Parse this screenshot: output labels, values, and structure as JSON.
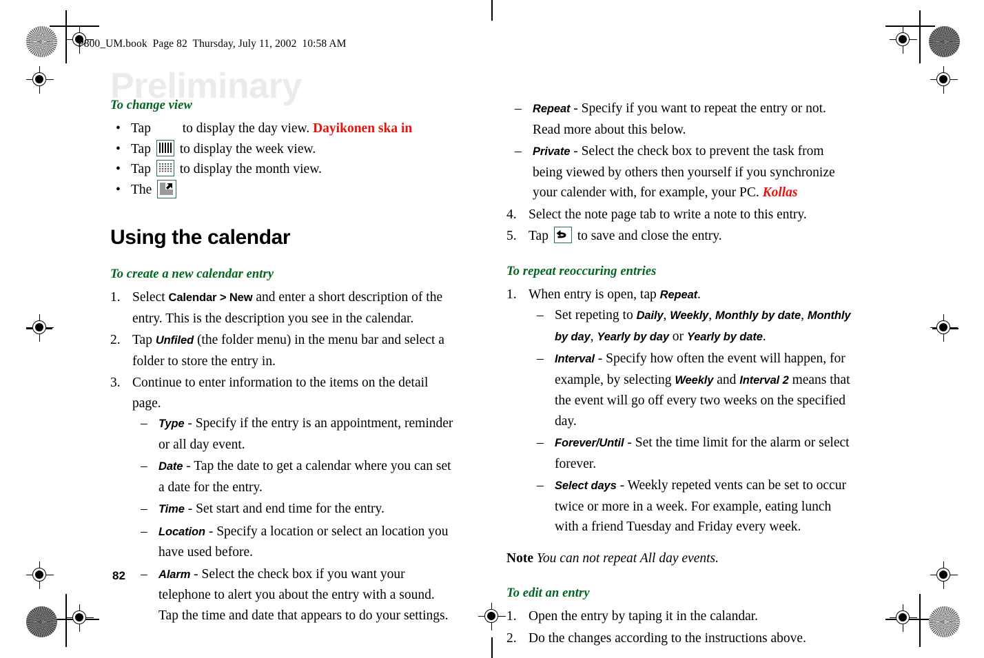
{
  "document": {
    "running_header": "P800_UM.book  Page 82  Thursday, July 11, 2002  10:58 AM",
    "watermark": "Preliminary",
    "page_number": "82"
  },
  "colors": {
    "heading_green": "#00661f",
    "alert_red": "#e8140c",
    "icon_border_green": "#2a6b55",
    "watermark_gray": "#ebebeb"
  },
  "left_column": {
    "section_to_change_view": {
      "heading": "To change view",
      "bullets": [
        {
          "lead": "Tap",
          "icon": "day-view-icon",
          "text": "to display the day view.",
          "alert": "Dayikonen ska in"
        },
        {
          "lead": "Tap",
          "icon": "week-view-icon",
          "text": "to display the week view.",
          "alert": ""
        },
        {
          "lead": "Tap",
          "icon": "month-view-icon",
          "text": "to display the month view.",
          "alert": ""
        },
        {
          "lead": "The",
          "icon": "minimize-corner-icon",
          "text": "",
          "alert": ""
        }
      ]
    },
    "main_heading": "Using the calendar",
    "section_create_entry": {
      "heading": "To create a new calendar entry",
      "steps": [
        {
          "num": "1.",
          "pre": "Select ",
          "ui": "Calendar > New",
          "post": " and enter a short description of the entry. This is the description you see in the calendar."
        },
        {
          "num": "2.",
          "pre": "Tap ",
          "ui": "Unfiled",
          "post": " (the folder menu) in the menu bar and select a folder to store the entry in."
        },
        {
          "num": "3.",
          "pre": "Continue to enter information to the items on the detail page.",
          "ui": "",
          "post": ""
        }
      ],
      "sub_items": [
        {
          "term": "Type",
          "text": " - Specify if the entry is an appointment, reminder or all day event."
        },
        {
          "term": "Date",
          "text": " - Tap the date to get a calendar where you can set a date for the entry."
        },
        {
          "term": "Time",
          "text": " - Set start and end time for the entry."
        },
        {
          "term": "Location",
          "text": " - Specify a location or select an location you have used before."
        },
        {
          "term": "Alarm",
          "text": " - Select the check box if you want your telephone to alert you about the entry with a sound. Tap the time and date that appears to do your settings."
        }
      ]
    }
  },
  "right_column": {
    "continued_sub_items": [
      {
        "term": "Repeat",
        "text": " - Specify if you want to repeat the entry or not. Read more about this below.",
        "alert": ""
      },
      {
        "term": "Private",
        "text": " - Select the check box to prevent the task from being viewed by others then yourself if you synchronize your calender with, for example, your PC. ",
        "alert": "Kollas"
      }
    ],
    "steps_continued": [
      {
        "num": "4.",
        "pre": "Select the note page tab to write a note to this entry.",
        "icon": "",
        "post": ""
      },
      {
        "num": "5.",
        "pre": "Tap ",
        "icon": "back-arrow-icon",
        "post": " to save and close the entry."
      }
    ],
    "section_repeat": {
      "heading": "To repeat reoccuring entries",
      "step": {
        "num": "1.",
        "pre": "When entry is open, tap ",
        "ui": "Repeat",
        "post": "."
      },
      "sub_items": [
        {
          "term": "",
          "text_parts": [
            "Set repeting to ",
            "Daily",
            ", ",
            "Weekly",
            ", ",
            "Monthly by date",
            ", ",
            "Monthly by day",
            ", ",
            "Yearly by day",
            " or ",
            "Yearly by date",
            "."
          ]
        },
        {
          "term": "Interval",
          "text_parts": [
            " - Specify how often the event will happen, for example, by selecting ",
            "Weekly",
            " and ",
            "Interval 2",
            " means that the event will go off every two weeks on the specified day."
          ]
        },
        {
          "term": "Forever/Until",
          "text_parts": [
            " - Set the time limit for the alarm or select forever."
          ]
        },
        {
          "term": "Select days",
          "text_parts": [
            " - Weekly repeted vents can be set to occur twice or more in a week. For example, eating lunch with a friend Tuesday and Friday every week."
          ]
        }
      ]
    },
    "note": {
      "label": "Note",
      "body": "You can not repeat All day events."
    },
    "section_edit": {
      "heading": "To edit an entry",
      "steps": [
        {
          "num": "1.",
          "text": "Open the entry by taping it in the calandar."
        },
        {
          "num": "2.",
          "text": "Do the changes according to the instructions above."
        }
      ]
    }
  }
}
